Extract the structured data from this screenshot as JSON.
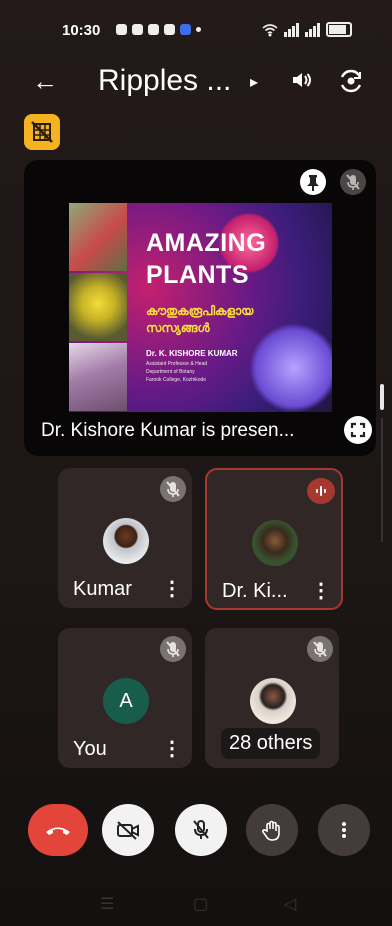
{
  "status": {
    "time": "10:30"
  },
  "header": {
    "back_icon": "arrow-left-icon",
    "title": "Ripples ...",
    "caret": "▸"
  },
  "presentation": {
    "slide": {
      "title_line1": "AMAZING",
      "title_line2": "PLANTS",
      "malayalam_line1": "കൗതുകരൂപികളായ",
      "malayalam_line2": "സസ്യങ്ങൾ",
      "presenter_name": "Dr. K. KISHORE KUMAR",
      "line1": "Assistant Professor & Head",
      "line2": "Department of Botany",
      "line3": "Farook College, Kozhikode"
    },
    "caption": "Dr. Kishore Kumar is presen..."
  },
  "tiles": [
    {
      "name": "Kumar",
      "state": "muted"
    },
    {
      "name": "Dr. Ki...",
      "state": "speaking"
    },
    {
      "name": "You",
      "avatar_letter": "A",
      "state": "muted"
    },
    {
      "name": "28 others",
      "state": "muted"
    }
  ],
  "colors": {
    "end_call": "#e4453a",
    "speaking": "#a6392f",
    "badge": "#f6b321"
  }
}
